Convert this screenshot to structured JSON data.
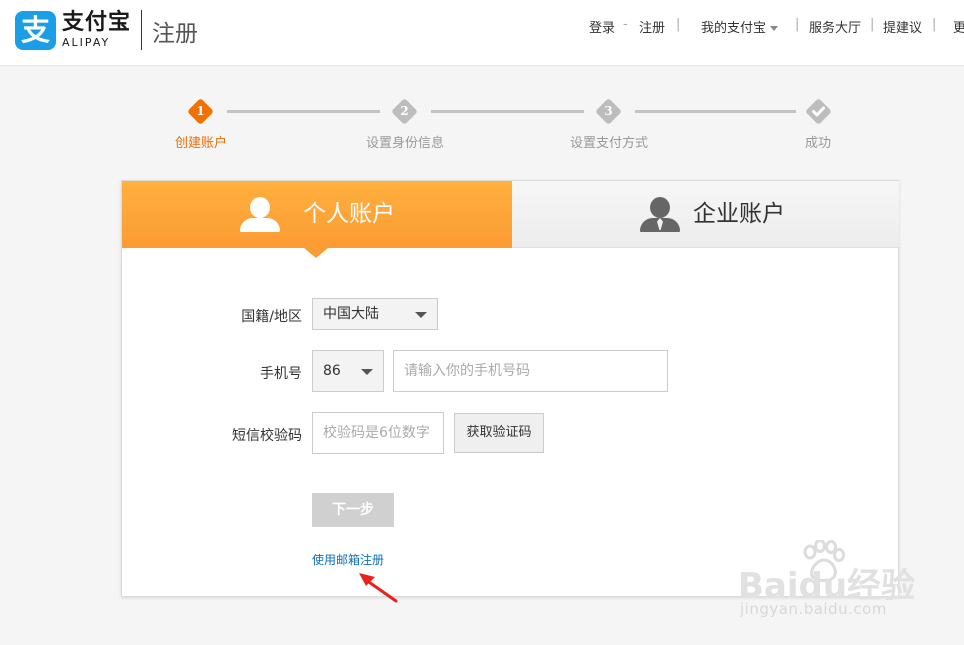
{
  "header": {
    "logo": {
      "glyph": "支",
      "cn": "支付宝",
      "en": "ALIPAY",
      "brand_color": "#1a9fe6"
    },
    "page_title": "注册",
    "nav": [
      {
        "label": "登录"
      },
      {
        "label": "注册"
      },
      {
        "label": "我的支付宝"
      },
      {
        "label": "服务大厅"
      },
      {
        "label": "提建议"
      },
      {
        "label": "更"
      }
    ],
    "separators": [
      "-",
      "|",
      "|",
      "|",
      "|",
      "|"
    ]
  },
  "steps": [
    {
      "num": "1",
      "label": "创建账户",
      "active": true
    },
    {
      "num": "2",
      "label": "设置身份信息",
      "active": false
    },
    {
      "num": "3",
      "label": "设置支付方式",
      "active": false
    },
    {
      "num": "",
      "label": "成功",
      "active": false,
      "icon": "check-icon"
    }
  ],
  "tabs": {
    "personal": {
      "label": "个人账户",
      "icon": "person-icon",
      "selected": true
    },
    "business": {
      "label": "企业账户",
      "icon": "business-person-icon",
      "selected": false
    }
  },
  "form": {
    "nationality": {
      "label": "国籍/地区",
      "value": "中国大陆"
    },
    "phone": {
      "label": "手机号",
      "country_code": "86",
      "placeholder": "请输入你的手机号码"
    },
    "sms": {
      "label": "短信校验码",
      "placeholder": "校验码是6位数字",
      "get_code_label": "获取验证码"
    },
    "next_label": "下一步",
    "email_register_label": "使用邮箱注册"
  },
  "watermark": {
    "main": "Baidu经验",
    "sub": "jingyan.baidu.com"
  },
  "colors": {
    "accent_orange": "#fc9b33",
    "active_step": "#f07000",
    "link_blue": "#0b6fb7",
    "arrow_red": "#e8231b"
  }
}
